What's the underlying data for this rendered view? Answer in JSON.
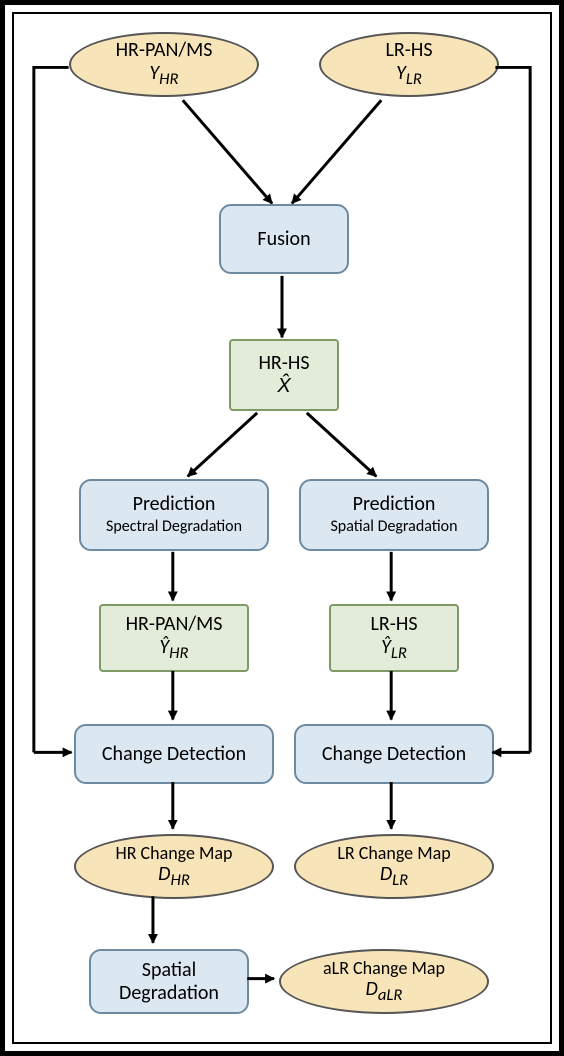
{
  "nodes": {
    "input_hr": {
      "line1": "HR-PAN/MS",
      "var": "Y",
      "sub": "HR"
    },
    "input_lr": {
      "line1": "LR-HS",
      "var": "Y",
      "sub": "LR"
    },
    "fusion": {
      "label": "Fusion"
    },
    "hrhs": {
      "line1": "HR-HS",
      "var": "X̂"
    },
    "pred_spectral": {
      "line1": "Prediction",
      "line2": "Spectral Degradation"
    },
    "pred_spatial": {
      "line1": "Prediction",
      "line2": "Spatial Degradation"
    },
    "yhat_hr": {
      "line1": "HR-PAN/MS",
      "var": "Ŷ",
      "sub": "HR"
    },
    "yhat_lr": {
      "line1": "LR-HS",
      "var": "Ŷ",
      "sub": "LR"
    },
    "cd_left": {
      "label": "Change Detection"
    },
    "cd_right": {
      "label": "Change Detection"
    },
    "dhr": {
      "line1": "HR Change Map",
      "var": "D",
      "sub": "HR"
    },
    "dlr": {
      "line1": "LR Change Map",
      "var": "D",
      "sub": "LR"
    },
    "spatial_deg": {
      "line1": "Spatial",
      "line2": "Degradation"
    },
    "dalr": {
      "line1": "aLR Change Map",
      "var": "D",
      "sub": "aLR"
    }
  }
}
